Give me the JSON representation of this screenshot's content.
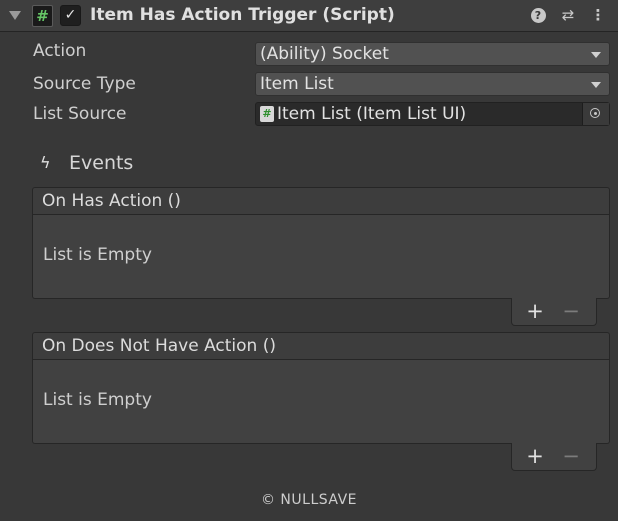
{
  "component": {
    "title": "Item Has Action Trigger (Script)",
    "script_glyph": "#",
    "enabled_glyph": "✓",
    "help_glyph": "?",
    "presets_glyph": "⇄",
    "menu_glyph": "⋮",
    "foldout_state": "expanded"
  },
  "properties": {
    "action": {
      "label": "Action",
      "value": "(Ability) Socket"
    },
    "source_type": {
      "label": "Source Type",
      "value": "Item List"
    },
    "list_source": {
      "label": "List Source",
      "value": "Item List (Item List UI)",
      "icon_glyph": "#"
    }
  },
  "events": {
    "header_label": "Events",
    "header_icon_glyph": "ϟ",
    "items": [
      {
        "title": "On Has Action ()",
        "empty_text": "List is Empty",
        "add_glyph": "+",
        "remove_glyph": "−"
      },
      {
        "title": "On Does Not Have Action ()",
        "empty_text": "List is Empty",
        "add_glyph": "+",
        "remove_glyph": "−"
      }
    ]
  },
  "footer": {
    "copyright": "© NULLSAVE"
  },
  "colors": {
    "background": "#383838",
    "header_background": "#3e3e3e",
    "field_background": "#515151",
    "object_field_background": "#2a2a2a",
    "script_icon_green": "#66c666"
  }
}
